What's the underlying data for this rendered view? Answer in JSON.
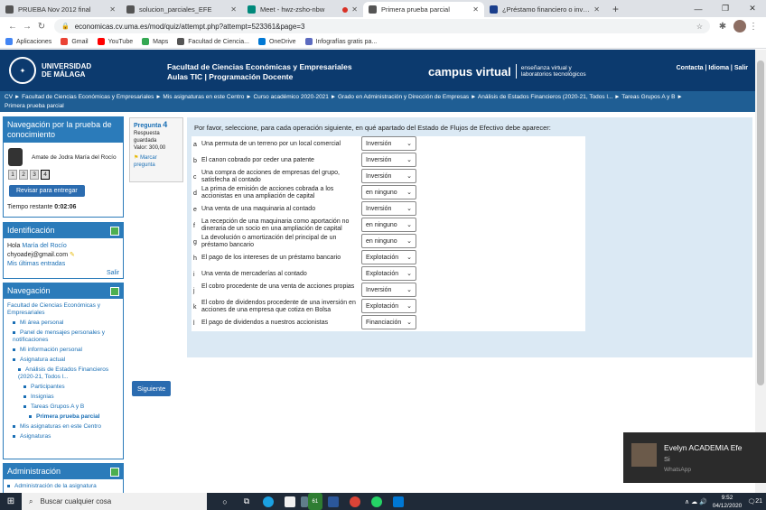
{
  "browser": {
    "tabs": [
      {
        "title": "PRUEBA Nov 2012 final",
        "color": "#555555"
      },
      {
        "title": "solucion_parciales_EFE",
        "color": "#555555"
      },
      {
        "title": "Meet - hwz-zsho-nbw",
        "color": "#00897b"
      },
      {
        "title": "Primera prueba parcial",
        "color": "#555555"
      },
      {
        "title": "¿Préstamo financiero o inversión",
        "color": "#1a3e8c"
      }
    ],
    "active_tab": 3,
    "url": "economicas.cv.uma.es/mod/quiz/attempt.php?attempt=523361&page=3",
    "bookmarks": [
      {
        "label": "Aplicaciones",
        "color": "#4285f4"
      },
      {
        "label": "Gmail",
        "color": "#ea4335"
      },
      {
        "label": "YouTube",
        "color": "#ff0000"
      },
      {
        "label": "Maps",
        "color": "#34a853"
      },
      {
        "label": "Facultad de Ciencia...",
        "color": "#555555"
      },
      {
        "label": "OneDrive",
        "color": "#0078d4"
      },
      {
        "label": "Infografías gratis pa...",
        "color": "#5c6bc0"
      }
    ]
  },
  "header": {
    "uni_name_1": "UNIVERSIDAD",
    "uni_name_2": "DE MÁLAGA",
    "faculty": "Facultad de Ciencias Económicas y Empresariales",
    "faculty_sub": "Aulas TIC | Programación Docente",
    "campus": "campus virtual",
    "campus_sub_1": "enseñanza virtual y",
    "campus_sub_2": "laboratorios tecnológicos",
    "top_links": "Contacta | Idioma | Salir"
  },
  "breadcrumb": {
    "line1": "CV ► Facultad de Ciencias Económicas y Empresariales ► Mis asignaturas en este Centro ► Curso académico 2020-2021 ► Grado en Administración y Dirección de Empresas ► Análisis de Estados Financieros (2020-21, Todos l... ► Tareas Grupos A y B ►",
    "line2": "Primera prueba parcial"
  },
  "quiz_nav": {
    "title": "Navegación por la prueba de conocimiento",
    "user": "Amate de Jodra María del Rocío",
    "questions": [
      "1",
      "2",
      "3",
      "4"
    ],
    "current": 3,
    "submit_label": "Revisar para entregar",
    "time_label": "Tiempo restante",
    "time_value": "0:02:06"
  },
  "identification": {
    "title": "Identificación",
    "hello": "Hola",
    "name": "María del Rocío",
    "email": "chyoadej@gmail.com",
    "last_entries": "Mis últimas entradas",
    "logout": "Salir"
  },
  "navigation": {
    "title": "Navegación",
    "items": [
      "Facultad de Ciencias Económicas y Empresariales",
      "Mi área personal",
      "Panel de mensajes personales y notificaciones",
      "Mi información personal",
      "Asignatura actual",
      "Análisis de Estados Financieros (2020-21, Todos l...",
      "Participantes",
      "Insignias",
      "Tareas Grupos A y B",
      "Primera prueba parcial",
      "Mis asignaturas en este Centro",
      "Asignaturas"
    ]
  },
  "administration": {
    "title": "Administración",
    "item": "Administración de la asignatura"
  },
  "question_info": {
    "label": "Pregunta",
    "number": "4",
    "status": "Respuesta guardada",
    "value": "Valor: 300,00",
    "flag": "Marcar pregunta"
  },
  "question": {
    "prompt": "Por favor, seleccione, para cada operación siguiente, en qué apartado del Estado de Flujos de Efectivo debe aparecer:",
    "rows": [
      {
        "letter": "a",
        "text": "Una permuta de un terreno por un local comercial",
        "answer": "Inversión"
      },
      {
        "letter": "b",
        "text": "El canon cobrado por ceder una patente",
        "answer": "Inversión"
      },
      {
        "letter": "c",
        "text": "Una compra de acciones de empresas del grupo, satisfecha al contado",
        "answer": "Inversión"
      },
      {
        "letter": "d",
        "text": "La prima de emisión de acciones cobrada a los accionistas en una ampliación de capital",
        "answer": "en ninguno"
      },
      {
        "letter": "e",
        "text": "Una venta de una maquinaria al contado",
        "answer": "Inversión"
      },
      {
        "letter": "f",
        "text": "La recepción de una maquinaria como aportación no dineraria de un socio en una ampliación de capital",
        "answer": "en ninguno"
      },
      {
        "letter": "g",
        "text": "La devolución o amortización del principal de un préstamo bancario",
        "answer": "en ninguno"
      },
      {
        "letter": "h",
        "text": "El pago de los intereses de un préstamo bancario",
        "answer": "Explotación"
      },
      {
        "letter": "i",
        "text": "Una venta de mercaderías al contado",
        "answer": "Explotación"
      },
      {
        "letter": "j",
        "text": "El cobro procedente de una venta de acciones propias",
        "answer": "Inversión"
      },
      {
        "letter": "k",
        "text": "El cobro de dividendos procedente de una inversión en acciones de una empresa que cotiza en Bolsa",
        "answer": "Explotación"
      },
      {
        "letter": "l",
        "text": "El pago de dividendos a nuestros accionistas",
        "answer": "Financiación"
      }
    ],
    "next_label": "Siguiente"
  },
  "toast": {
    "name": "Evelyn ACADEMIA Efe",
    "message": "Si",
    "app": "WhatsApp"
  },
  "taskbar": {
    "search": "Buscar cualquier cosa",
    "time": "9:52",
    "date": "04/12/2020",
    "badge_1": "61",
    "badge_2": "21"
  }
}
